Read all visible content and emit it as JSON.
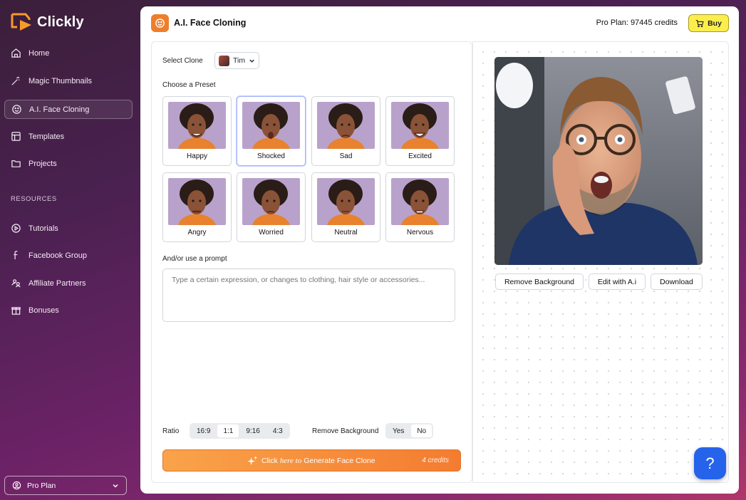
{
  "brand": {
    "name": "Clickly"
  },
  "nav": [
    {
      "label": "Home",
      "icon": "home-icon"
    },
    {
      "label": "Magic Thumbnails",
      "icon": "magic-wand-icon"
    },
    {
      "label": "A.I. Face Cloning",
      "icon": "smile-icon",
      "active": true
    },
    {
      "label": "Templates",
      "icon": "layout-icon"
    },
    {
      "label": "Projects",
      "icon": "folder-icon"
    }
  ],
  "resources": {
    "heading": "RESOURCES",
    "items": [
      {
        "label": "Tutorials",
        "icon": "play-circle-icon"
      },
      {
        "label": "Facebook Group",
        "icon": "facebook-icon"
      },
      {
        "label": "Affiliate Partners",
        "icon": "users-icon"
      },
      {
        "label": "Bonuses",
        "icon": "gift-icon"
      }
    ]
  },
  "plan_select": {
    "label": "Pro Plan"
  },
  "header": {
    "title": "A.I. Face Cloning",
    "credits": "Pro Plan: 97445 credits",
    "buy_label": "Buy"
  },
  "form": {
    "select_clone_label": "Select Clone",
    "clone_value": "Tim",
    "preset_heading": "Choose a Preset",
    "presets": [
      {
        "label": "Happy"
      },
      {
        "label": "Shocked",
        "selected": true
      },
      {
        "label": "Sad"
      },
      {
        "label": "Excited"
      },
      {
        "label": "Angry"
      },
      {
        "label": "Worried"
      },
      {
        "label": "Neutral"
      },
      {
        "label": "Nervous"
      }
    ],
    "prompt_label": "And/or use a prompt",
    "prompt_placeholder": "Type a certain expression, or changes to clothing, hair style or accessories...",
    "ratio_label": "Ratio",
    "ratios": [
      "16:9",
      "1:1",
      "9:16",
      "4:3"
    ],
    "ratio_selected": "1:1",
    "remove_bg_label": "Remove Background",
    "remove_bg_options": [
      "Yes",
      "No"
    ],
    "remove_bg_selected": "No",
    "generate": {
      "pre": "Click",
      "em": "here to",
      "post": "Generate Face Clone",
      "credits": "4 credits"
    }
  },
  "result": {
    "actions": [
      "Remove Background",
      "Edit with A.i",
      "Download"
    ]
  },
  "help_label": "?",
  "colors": {
    "accent": "#ee7e2c",
    "buy": "#fbee4c",
    "help": "#2563eb"
  }
}
